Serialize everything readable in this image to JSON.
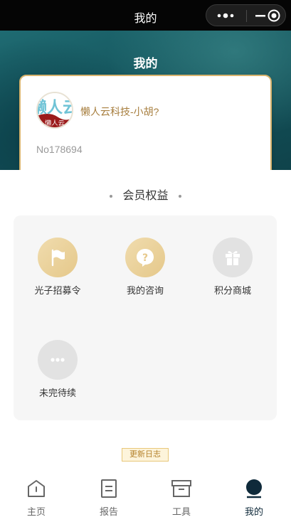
{
  "navbar": {
    "title": "我的"
  },
  "hero": {
    "title": "我的"
  },
  "profile": {
    "avatar_text": "懒人云",
    "username": "懒人云科技-小胡?",
    "member_no": "No178694"
  },
  "benefits": {
    "title": "会员权益",
    "items": [
      {
        "label": "光子招募令",
        "icon": "flag-icon",
        "style": "gold"
      },
      {
        "label": "我的咨询",
        "icon": "question-icon",
        "style": "gold"
      },
      {
        "label": "积分商城",
        "icon": "gift-icon",
        "style": "grey"
      },
      {
        "label": "未完待续",
        "icon": "more-icon",
        "style": "grey"
      }
    ]
  },
  "changelog": {
    "label": "更新日志"
  },
  "tabbar": {
    "items": [
      {
        "label": "主页",
        "icon": "home-icon",
        "active": false
      },
      {
        "label": "报告",
        "icon": "report-icon",
        "active": false
      },
      {
        "label": "工具",
        "icon": "toolbox-icon",
        "active": false
      },
      {
        "label": "我的",
        "icon": "profile-icon",
        "active": true
      }
    ]
  },
  "colors": {
    "accent": "#d8b36d",
    "username": "#a77e3e",
    "navbar": "#050505",
    "hero": "#14545c",
    "active_tab": "#0f2a3a"
  }
}
